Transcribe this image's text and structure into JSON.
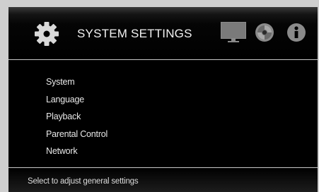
{
  "header": {
    "title": "SYSTEM SETTINGS",
    "icons": [
      "gear-icon",
      "monitor-icon",
      "disc-icon",
      "info-icon"
    ]
  },
  "menu": {
    "items": [
      {
        "label": "System"
      },
      {
        "label": "Language"
      },
      {
        "label": "Playback"
      },
      {
        "label": "Parental Control"
      },
      {
        "label": "Network"
      }
    ]
  },
  "footer": {
    "status_text": "Select to adjust general settings"
  },
  "colors": {
    "background": "#000000",
    "text": "#f2f2f2",
    "divider": "#c8c8c8",
    "monitor_screen": "#7f7f7f"
  }
}
